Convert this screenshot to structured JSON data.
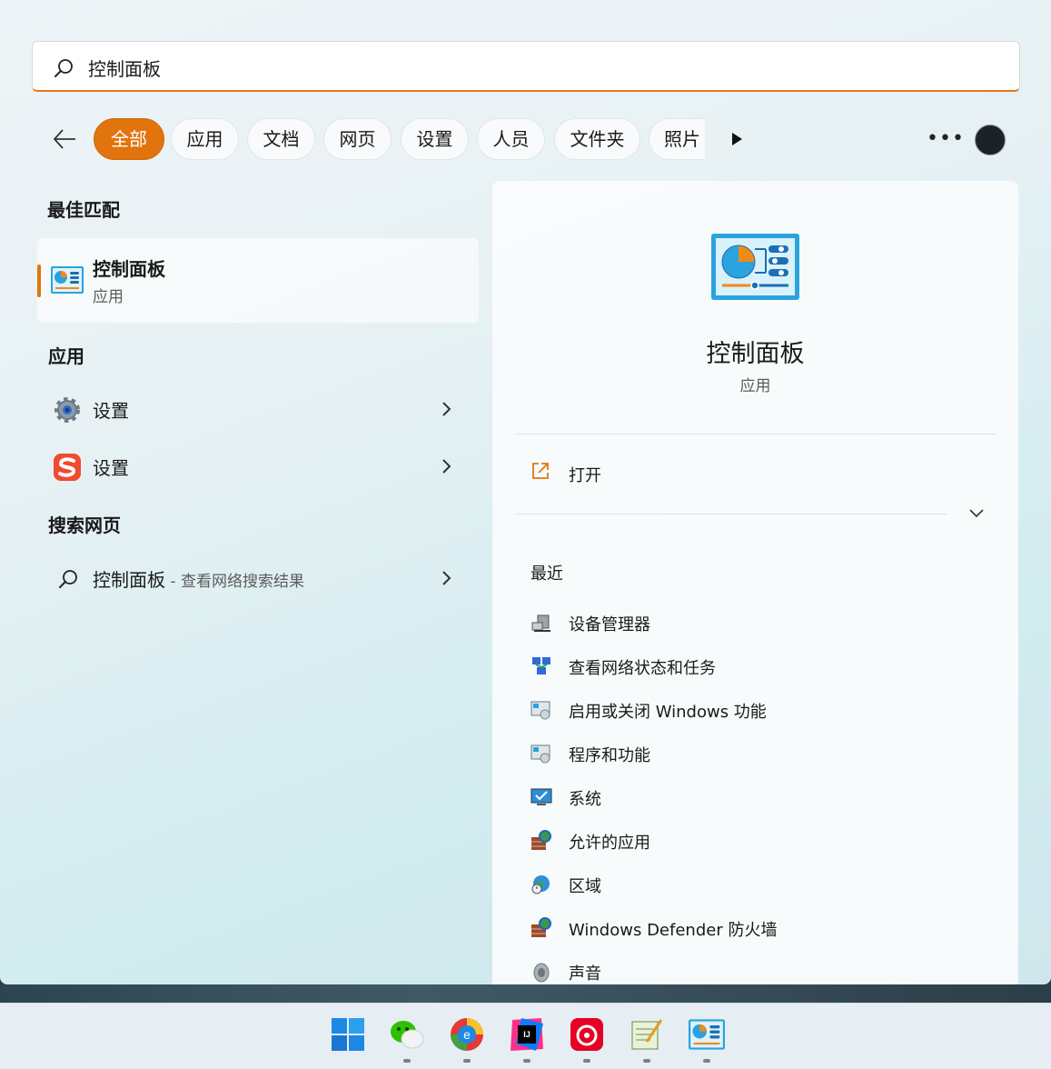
{
  "search": {
    "query": "控制面板"
  },
  "filters": [
    {
      "label": "全部",
      "active": true
    },
    {
      "label": "应用"
    },
    {
      "label": "文档"
    },
    {
      "label": "网页"
    },
    {
      "label": "设置"
    },
    {
      "label": "人员"
    },
    {
      "label": "文件夹"
    },
    {
      "label": "照片"
    }
  ],
  "best_match": {
    "section_title": "最佳匹配",
    "name": "控制面板",
    "kind": "应用"
  },
  "apps": {
    "section_title": "应用",
    "items": [
      {
        "label": "设置",
        "icon": "settings-gear-icon"
      },
      {
        "label": "设置",
        "icon": "sogou-settings-icon"
      }
    ]
  },
  "web": {
    "section_title": "搜索网页",
    "query": "控制面板",
    "suffix": " - 查看网络搜索结果"
  },
  "detail": {
    "name": "控制面板",
    "kind": "应用",
    "open_label": "打开",
    "recent_title": "最近",
    "recent": [
      {
        "label": "设备管理器",
        "icon": "device-manager-icon"
      },
      {
        "label": "查看网络状态和任务",
        "icon": "network-status-icon"
      },
      {
        "label": "启用或关闭 Windows 功能",
        "icon": "windows-features-icon"
      },
      {
        "label": "程序和功能",
        "icon": "programs-features-icon"
      },
      {
        "label": "系统",
        "icon": "system-icon"
      },
      {
        "label": "允许的应用",
        "icon": "firewall-icon"
      },
      {
        "label": "区域",
        "icon": "region-icon"
      },
      {
        "label": "Windows Defender 防火墙",
        "icon": "firewall-icon"
      },
      {
        "label": "声音",
        "icon": "sound-icon"
      }
    ]
  },
  "taskbar": {
    "apps": [
      "start-icon",
      "wechat-icon",
      "edge-icon",
      "intellij-icon",
      "netease-music-icon",
      "notepad-icon",
      "control-panel-icon"
    ]
  },
  "colors": {
    "accent": "#e2740e"
  }
}
